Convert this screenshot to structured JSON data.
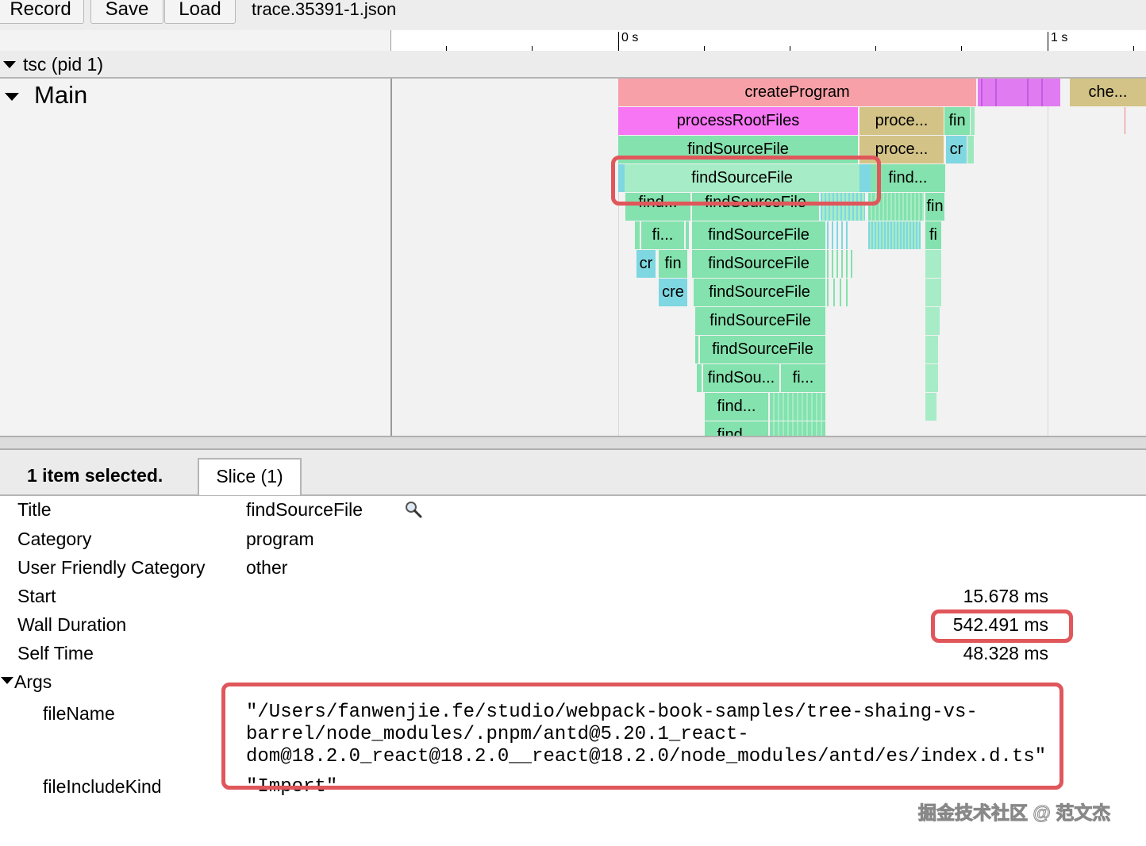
{
  "toolbar": {
    "record_label": "Record",
    "save_label": "Save",
    "load_label": "Load",
    "trace_file": "trace.35391-1.json"
  },
  "ruler": {
    "label_0": "0 s",
    "label_1": "1 s"
  },
  "process": {
    "label": "tsc (pid 1)"
  },
  "track": {
    "thread_label": "Main",
    "slices": {
      "createProgram": "createProgram",
      "che": "che...",
      "processRootFiles": "processRootFiles",
      "proce1": "proce...",
      "fin1": "fin",
      "findSourceFile1": "findSourceFile",
      "proce2": "proce...",
      "cr1": "cr",
      "findSourceFile2": "findSourceFile",
      "find1": "find...",
      "find2": "find...",
      "findSourceFile_partial": "findSourceFile",
      "fin2": "fin",
      "fi1": "fi...",
      "findSourceFile3": "findSourceFile",
      "fi2": "fi",
      "cr2": "cr",
      "fin3": "fin",
      "findSourceFile4": "findSourceFile",
      "cre": "cre",
      "findSourceFile5": "findSourceFile",
      "findSourceFile6": "findSourceFile",
      "findSourceFile7": "findSourceFile",
      "findSou": "findSou...",
      "fi3": "fi...",
      "find3": "find...",
      "find4": "find..."
    }
  },
  "selection": {
    "count_label": "1 item selected.",
    "tab_label": "Slice (1)"
  },
  "details": {
    "title_label": "Title",
    "title_value": "findSourceFile",
    "category_label": "Category",
    "category_value": "program",
    "ufc_label": "User Friendly Category",
    "ufc_value": "other",
    "start_label": "Start",
    "start_value": "15.678 ms",
    "wall_label": "Wall Duration",
    "wall_value": "542.491 ms",
    "self_label": "Self Time",
    "self_value": "48.328 ms",
    "args_label": "Args",
    "filename_label": "fileName",
    "filename_line1": "\"/Users/fanwenjie.fe/studio/webpack-book-samples/tree-shaing-vs-",
    "filename_line2": "barrel/node_modules/.pnpm/antd@5.20.1_react-",
    "filename_line3": "dom@18.2.0_react@18.2.0__react@18.2.0/node_modules/antd/es/index.d.ts\"",
    "fileinclude_label": "fileIncludeKind",
    "fileinclude_value": "\"Import\""
  },
  "watermark": "掘金技术社区 @ 范文杰",
  "colors": {
    "createProgram": "#f8a0a7",
    "processRootFiles": "#f676f4",
    "findSourceFile": "#83e2ad",
    "proce": "#d3c386",
    "cr": "#7ed7e1",
    "highlight": "#e0575b"
  }
}
